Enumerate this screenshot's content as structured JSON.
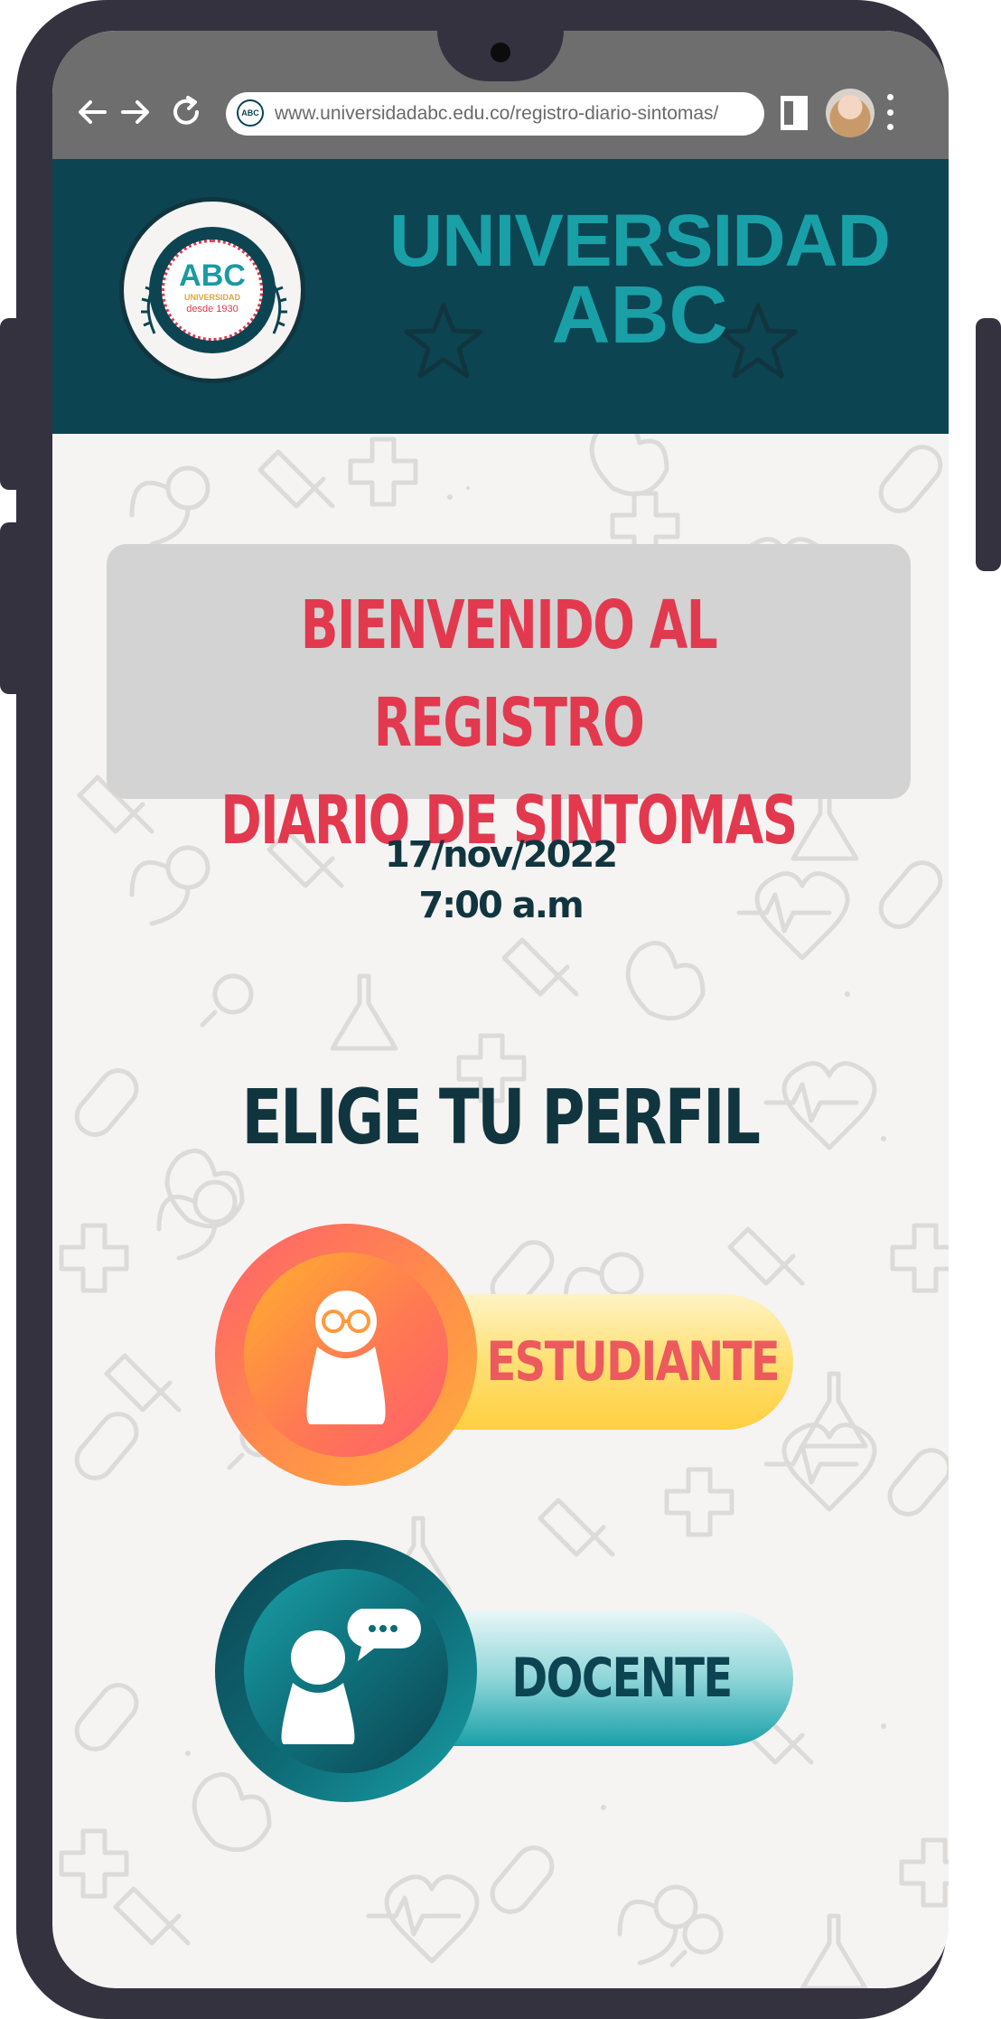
{
  "browser": {
    "url": "www.universidadabc.edu.co/registro-diario-sintomas/",
    "favicon_text": "ABC",
    "icons": [
      "back-arrow-icon",
      "forward-arrow-icon",
      "reload-icon",
      "tab-view-icon",
      "profile-avatar",
      "more-menu-icon"
    ]
  },
  "header": {
    "logo": {
      "abc": "ABC",
      "university": "UNIVERSIDAD",
      "since": "desde 1930"
    },
    "title_line1": "UNIVERSIDAD",
    "title_line2": "ABC"
  },
  "welcome": {
    "line1": "BIENVENIDO AL REGISTRO",
    "line2": "DIARIO DE SINTOMAS"
  },
  "datetime": {
    "date": "17/nov/2022",
    "time": "7:00 a.m"
  },
  "choose_profile": "ELIGE TU PERFIL",
  "profiles": [
    {
      "label": "ESTUDIANTE",
      "icon": "student-icon"
    },
    {
      "label": "DOCENTE",
      "icon": "teacher-icon"
    }
  ],
  "colors": {
    "header_bg": "#0c4452",
    "accent_teal": "#19a0a7",
    "accent_red": "#e2394f",
    "text_dark": "#11353f",
    "phone_frame": "#34323f"
  }
}
